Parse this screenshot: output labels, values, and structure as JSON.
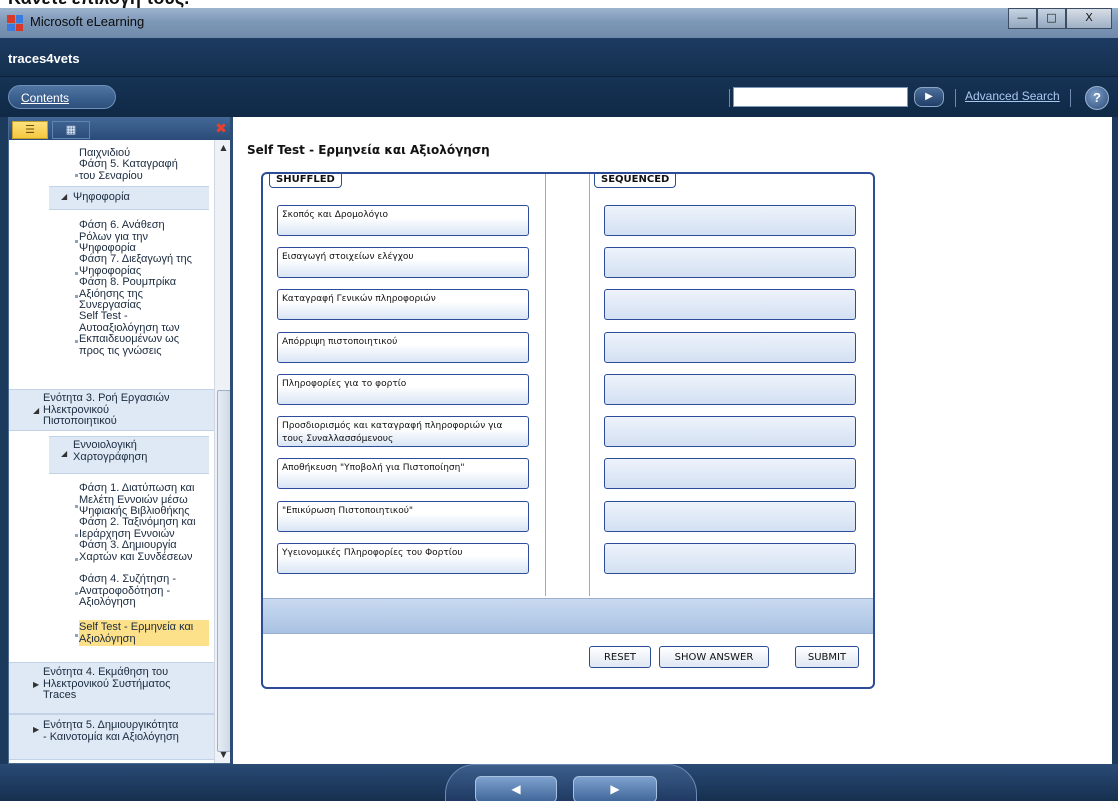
{
  "page": {
    "top_text": "Κάνετε επιλογή τους."
  },
  "window": {
    "title": "Microsoft eLearning",
    "min": "—",
    "max": "□",
    "close": "X"
  },
  "app": {
    "name": "traces4vets"
  },
  "navbar": {
    "contents_label": "Contents",
    "search_value": "",
    "go_symbol": "▶",
    "advanced_search": "Advanced Search",
    "help": "?"
  },
  "sidebar": {
    "tab_toc_icon": "☰",
    "tab_grid_icon": "▦",
    "close": "✖",
    "scroll_up": "▲",
    "scroll_down": "▼",
    "items": [
      "Παιχνιδιού",
      "Φάση 5. Καταγραφή\nτου Σεναρίου",
      "Ψηφοφορία",
      "Φάση 6. Ανάθεση\nΡόλων για την\nΨηφοφορία",
      "Φάση 7. Διεξαγωγή της\nΨηφοφορίας",
      "Φάση 8. Ρουμπρίκα\nΑξιόησης της\nΣυνεργασίας",
      "Self Test -\nΑυτοαξιολόγηση των\nΕκπαιδευομένων ως\nπρος τις γνώσεις",
      "Ενότητα 3. Ροή Εργασιών\nΗλεκτρονικού\nΠιστοποιητικού",
      "Εννοιολογική\nΧαρτογράφηση",
      "Φάση 1. Διατύπωση και\nΜελέτη Εννοιών μέσω\nΨηφιακής Βιβλιοθήκης",
      "Φάση 2. Ταξινόμηση και\nΙεράρχηση Εννοιών",
      "Φάση 3. Δημιουργία\nΧαρτών και Συνδέσεων",
      "Φάση 4. Συζήτηση -\nΑνατροφοδότηση -\nΑξιολόγηση",
      "Self Test - Ερμηνεία και\nΑξιολόγηση",
      "Ενότητα 4. Εκμάθηση του\nΗλεκτρονικού Συστήματος\nTraces",
      "Ενότητα 5. Δημιουργικότητα\n- Καινοτομία και Αξιολόγηση"
    ]
  },
  "content": {
    "title": "Self Test - Ερμηνεία και Αξιολόγηση",
    "shuffled_label": "SHUFFLED",
    "sequenced_label": "SEQUENCED",
    "cards": [
      "Σκοπός και Δρομολόγιο",
      "Εισαγωγή στοιχείων ελέγχου",
      "Καταγραφή Γενικών πληροφοριών",
      "Απόρριψη πιστοποιητικού",
      "Πληροφορίες για το φορτίο",
      "Προσδιορισμός και καταγραφή πληροφοριών για τους Συναλλασσόμενους",
      "Αποθήκευση \"Υποβολή για Πιστοποίηση\"",
      "\"Επικύρωση Πιστοποιητικού\"",
      "Υγειονομικές Πληροφορίες του Φορτίου"
    ],
    "buttons": {
      "reset": "RESET",
      "show_answer": "SHOW ANSWER",
      "submit": "SUBMIT"
    }
  },
  "bottom": {
    "prev": "◀",
    "next": "▶"
  },
  "colors": {
    "accent": "#2c4c97",
    "highlight": "#fde18a",
    "chrome": "#1b3a5c"
  }
}
